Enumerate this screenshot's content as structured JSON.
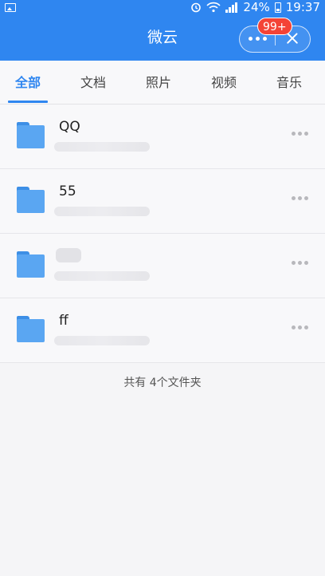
{
  "status_bar": {
    "battery": "24%",
    "time": "19:37",
    "left_icon": "image-icon",
    "icons": [
      "alarm-icon",
      "wifi-icon",
      "signal-icon",
      "battery-icon"
    ]
  },
  "nav": {
    "title": "微云",
    "badge": "99+"
  },
  "tabs": [
    "全部",
    "文档",
    "照片",
    "视频",
    "音乐"
  ],
  "active_tab": "全部",
  "folders": [
    {
      "name": "QQ"
    },
    {
      "name": "55"
    },
    {
      "name": ""
    },
    {
      "name": "ff"
    }
  ],
  "footer": "共有 4个文件夹",
  "colors": {
    "accent": "#2f86f0",
    "badge": "#f44336",
    "folder": "#5aa6f2"
  }
}
